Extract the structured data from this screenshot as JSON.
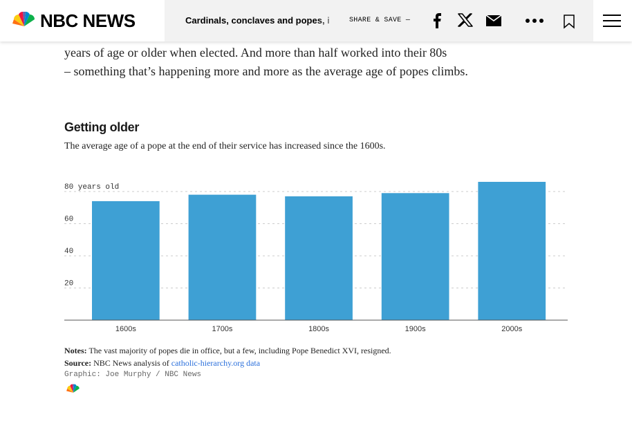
{
  "header": {
    "logo_text": "NBC NEWS",
    "headline": "Cardinals, conclaves and popes, i",
    "share_label": "SHARE & SAVE —",
    "icons": [
      "peacock-logo-icon",
      "facebook-icon",
      "x-icon",
      "email-icon",
      "more-icon",
      "bookmark-icon",
      "menu-icon"
    ]
  },
  "article": {
    "line1": "years of age or older when elected. And more than half worked into their 80s",
    "line2": "– something that’s happening more and more as the average age of popes climbs."
  },
  "chart_data": {
    "type": "bar",
    "title": "Getting older",
    "subtitle": "The average age of a pope at the end of their service has increased since the 1600s.",
    "categories": [
      "1600s",
      "1700s",
      "1800s",
      "1900s",
      "2000s"
    ],
    "values": [
      74,
      78,
      77,
      79,
      86
    ],
    "ytick_labels": [
      "80 years old",
      "60",
      "40",
      "20"
    ],
    "ytick_values": [
      80,
      60,
      40,
      20
    ],
    "ylim": [
      0,
      86
    ],
    "grid": true,
    "bar_color": "#3ea0d4",
    "grid_color": "#cccccc"
  },
  "notes": {
    "notes_label": "Notes:",
    "notes_text": "The vast majority of popes die in office, but a few, including Pope Benedict XVI, resigned.",
    "source_label": "Source:",
    "source_text": "NBC News analysis of",
    "source_link": "catholic-hierarchy.org data",
    "credit": "Graphic: Joe Murphy / NBC News"
  },
  "colors": {
    "link": "#2a6fdb",
    "text": "#222222"
  }
}
